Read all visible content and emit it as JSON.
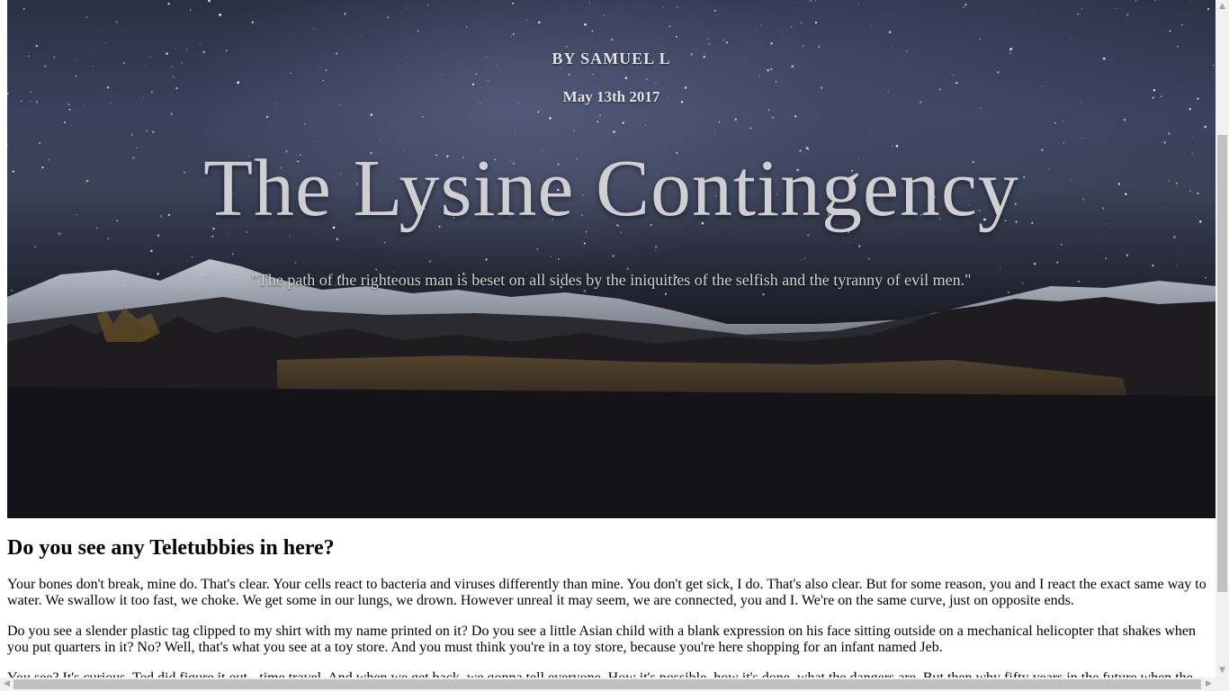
{
  "hero": {
    "byline": "BY SAMUEL L",
    "date": "May 13th 2017",
    "title": "The Lysine Contingency",
    "quote": "\"The path of the righteous man is beset on all sides by the iniquities of the selfish and the tyranny of evil men.\""
  },
  "article": {
    "heading": "Do you see any Teletubbies in here?",
    "paragraphs": [
      "Your bones don't break, mine do. That's clear. Your cells react to bacteria and viruses differently than mine. You don't get sick, I do. That's also clear. But for some reason, you and I react the exact same way to water. We swallow it too fast, we choke. We get some in our lungs, we drown. However unreal it may seem, we are connected, you and I. We're on the same curve, just on opposite ends.",
      "Do you see a slender plastic tag clipped to my shirt with my name printed on it? Do you see a little Asian child with a blank expression on his face sitting outside on a mechanical helicopter that shakes when you put quarters in it? No? Well, that's what you see at a toy store. And you must think you're in a toy store, because you're here shopping for an infant named Jeb.",
      "You see? It's curious. Ted did figure it out - time travel. And when we get back, we gonna tell everyone. How it's possible, how it's done, what the dangers are. But then why fifty years in the future when the"
    ]
  },
  "icons": {
    "scroll_up": "arrow-up-icon",
    "scroll_down": "arrow-down-icon",
    "scroll_left": "arrow-left-icon",
    "scroll_right": "arrow-right-icon"
  }
}
